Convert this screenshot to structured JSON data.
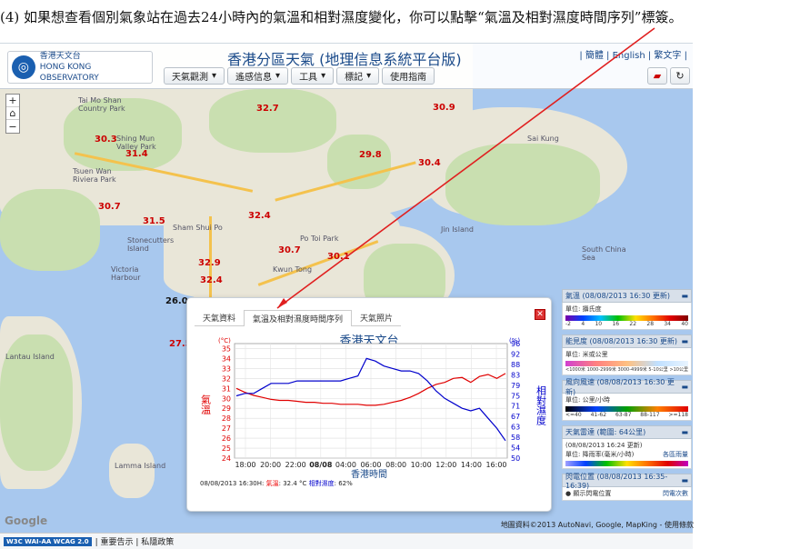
{
  "caption": "(4) 如果想查看個別氣象站在過去24小時內的氣溫和相對濕度變化，你可以點擊“氣溫及相對濕度時間序列”標簽。",
  "header": {
    "logo_cn": "香港天文台",
    "logo_en": "HONG KONG OBSERVATORY",
    "title": "香港分區天氣 (地理信息系統平台版)",
    "lang": "| 簡體 | English | 繁文字 |",
    "menu": [
      "天氣觀測",
      "遙感信息",
      "工具",
      "標記",
      "使用指南"
    ]
  },
  "map": {
    "temps": [
      "32.7",
      "30.9",
      "30.3",
      "31.4",
      "29.8",
      "30.4",
      "30.7",
      "31.5",
      "32.4",
      "30.7",
      "32.9",
      "30.1",
      "32.4",
      "26.0",
      "27.5"
    ],
    "places": [
      "Tai Mo Shan Country Park",
      "Shing Mun Valley Park",
      "Tsuen Wan Riviera Park",
      "Lantau Island",
      "Sham Shui Po",
      "Kwun Tong",
      "Po Toi Park",
      "Jin Island",
      "Stonecutters Island",
      "Victoria Harbour",
      "South China Sea",
      "Lamma Island",
      "Sai Kung"
    ],
    "google_text": "Google",
    "copyright": "地圖資料©2013 AutoNavi, Google, MapKing - 使用條款"
  },
  "popup": {
    "tabs": [
      "天氣資料",
      "氣溫及相對濕度時間序列",
      "天氣照片"
    ],
    "active_tab": 1,
    "chart_title": "香港天文台",
    "footer_time": "08/08/2013 16:30H:",
    "footer_temp_label": "氣溫",
    "footer_temp": ": 32.4 °C",
    "footer_rh_label": "相對濕度",
    "footer_rh": ": 62%"
  },
  "chart_data": {
    "type": "line",
    "title": "香港天文台",
    "xlabel": "香港時間",
    "ylabel_left": "氣溫",
    "ylabel_right": "相對濕度",
    "left_unit": "(°C)",
    "right_unit": "(%)",
    "x_ticks": [
      "18:00",
      "20:00",
      "22:00",
      "08/08",
      "04:00",
      "06:00",
      "08:00",
      "10:00",
      "12:00",
      "14:00",
      "16:00"
    ],
    "left_ticks": [
      24,
      25,
      26,
      27,
      28,
      29,
      30,
      31,
      32,
      33,
      34,
      35
    ],
    "right_ticks": [
      50,
      54,
      58,
      63,
      67,
      71,
      75,
      79,
      83,
      88,
      92,
      96
    ],
    "ylim_left": [
      24,
      35.5
    ],
    "ylim_right": [
      50,
      96
    ],
    "series": [
      {
        "name": "氣溫",
        "color": "#e00000",
        "values": [
          31.0,
          30.6,
          30.3,
          30.1,
          29.9,
          29.8,
          29.8,
          29.7,
          29.6,
          29.6,
          29.5,
          29.5,
          29.4,
          29.4,
          29.4,
          29.3,
          29.3,
          29.4,
          29.6,
          29.8,
          30.1,
          30.5,
          31.0,
          31.4,
          31.6,
          32.0,
          32.1,
          31.6,
          32.2,
          32.4,
          32.0,
          32.5
        ]
      },
      {
        "name": "相對濕度",
        "color": "#0000cc",
        "values": [
          75,
          76,
          76,
          78,
          80,
          80,
          80,
          81,
          81,
          81,
          81,
          81,
          81,
          82,
          83,
          90,
          89,
          87,
          86,
          85,
          85,
          84,
          81,
          77,
          74,
          72,
          70,
          69,
          70,
          66,
          62,
          57
        ]
      }
    ]
  },
  "right_panel": [
    {
      "title": "氣溫 (08/08/2013 16:30 更新)",
      "unit": "單位: 攝氏度",
      "scale": [
        "-2",
        "4",
        "10",
        "16",
        "22",
        "28",
        "34",
        "40"
      ]
    },
    {
      "title": "能見度 (08/08/2013 16:30 更新)",
      "unit": "單位: 米或公里",
      "scale": [
        "<1000米",
        "1000-2999米",
        "3000-4999米",
        "5-10公里",
        ">10公里"
      ]
    },
    {
      "title": "風向風速 (08/08/2013 16:30 更新)",
      "unit": "單位: 公里/小時",
      "scale": [
        "<=40",
        "41-62",
        "63-87",
        "88-117",
        ">=118"
      ]
    },
    {
      "title": "天氣雷達 (範圍: 64公里)",
      "subtitle": "(08/08/2013 16:24 更新)",
      "unit": "單位: 降雨率(毫米/小時)",
      "link": "各區雨量"
    },
    {
      "title": "閃電位置 (08/08/2013 16:35-16:39)",
      "unit": "顯示閃電位置",
      "link": "閃電次數"
    }
  ],
  "footer": {
    "w3c": "W3C WAI-AA WCAG 2.0",
    "links": "| 重要告示 | 私隱政策"
  }
}
